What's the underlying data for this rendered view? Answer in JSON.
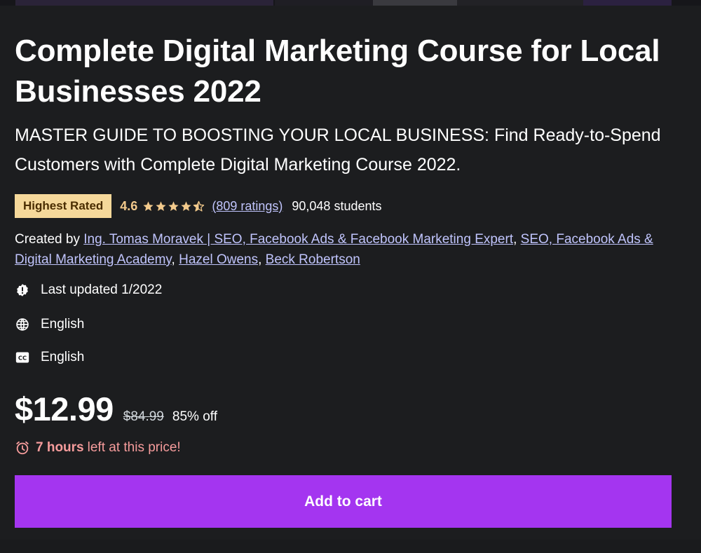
{
  "course": {
    "title": "Complete Digital Marketing Course for Local Businesses 2022",
    "subtitle": "MASTER GUIDE TO BOOSTING YOUR LOCAL BUSINESS: Find Ready-to-Spend Customers with Complete Digital Marketing Course 2022.",
    "badge": "Highest Rated",
    "rating": "4.6",
    "stars": 4.6,
    "ratings_count": "(809 ratings)",
    "students": "90,048 students",
    "created_by_label": "Created by",
    "instructors": [
      "Ing. Tomas Moravek | SEO, Facebook Ads & Facebook Marketing Expert",
      "SEO, Facebook Ads & Digital Marketing Academy",
      "Hazel Owens",
      "Beck Robertson"
    ],
    "separator": ", ",
    "last_updated": "Last updated 1/2022",
    "language": "English",
    "captions": "English"
  },
  "pricing": {
    "price": "$12.99",
    "original_price": "$84.99",
    "discount": "85% off",
    "timer_hours": "7 hours",
    "timer_text": "left at this price!"
  },
  "actions": {
    "add_to_cart": "Add to cart"
  },
  "icons": {
    "updated": "alert-badge-icon",
    "language": "globe-icon",
    "captions": "closed-captions-icon",
    "timer": "alarm-clock-icon",
    "star": "star-icon"
  },
  "colors": {
    "background": "#1c1d1f",
    "badge_bg": "#f5d89a",
    "rating": "#f3ca8c",
    "link": "#c0c4fc",
    "timer": "#f69c9c",
    "button": "#a435f0"
  }
}
